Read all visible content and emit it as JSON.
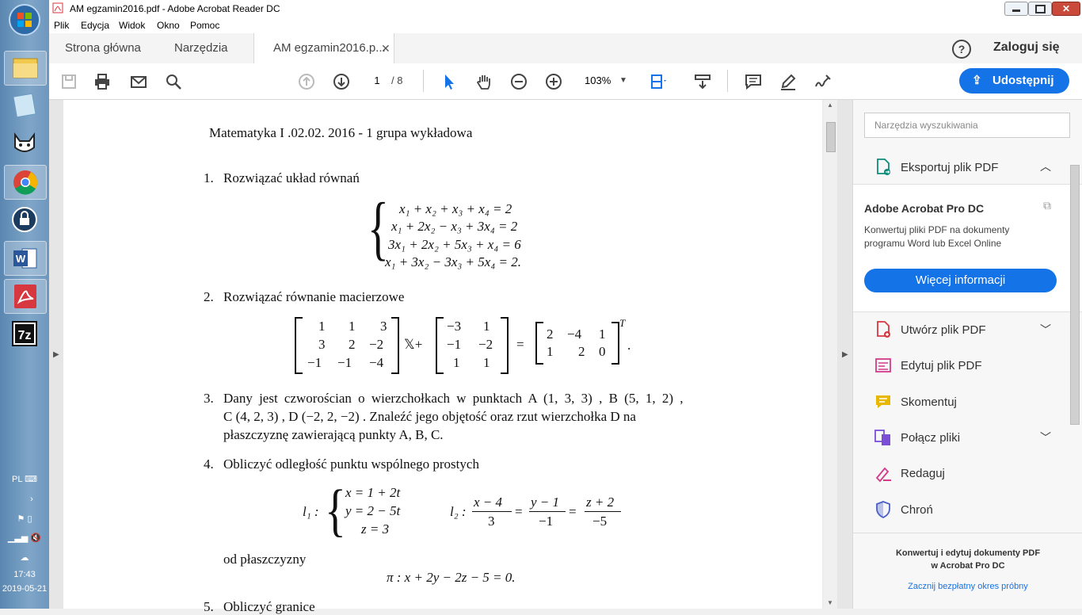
{
  "window": {
    "title": "AM egzamin2016.pdf - Adobe Acrobat Reader DC"
  },
  "menu": [
    "Plik",
    "Edycja",
    "Widok",
    "Okno",
    "Pomoc"
  ],
  "tabs": {
    "home": "Strona główna",
    "tools": "Narzędzia",
    "doc": "AM egzamin2016.p..."
  },
  "account": {
    "login": "Zaloguj się"
  },
  "toolbar": {
    "page_current": "1",
    "page_total": "/ 8",
    "zoom": "103%",
    "share": "Udostępnij"
  },
  "taskbar": {
    "lang": "PL",
    "time": "17:43",
    "date": "2019-05-21"
  },
  "document": {
    "header": "Matematyka I .02.02. 2016 - 1 grupa wykładowa",
    "p1": {
      "num": "1.",
      "text": "Rozwiązać układ równań",
      "eqs": [
        "x₁ + x₂ + x₃ + x₄ = 2",
        "x₁ + 2x₂ − x₃ + 3x₄ = 2",
        "3x₁ + 2x₂ + 5x₃ + x₄ = 6",
        "x₁ + 3x₂ − 3x₃ + 5x₄ = 2."
      ]
    },
    "p2": {
      "num": "2.",
      "text": "Rozwiązać równanie macierzowe",
      "m1": [
        [
          "1",
          "1",
          "3"
        ],
        [
          "3",
          "2",
          "−2"
        ],
        [
          "−1",
          "−1",
          "−4"
        ]
      ],
      "xplus": "𝕏+",
      "m2": [
        [
          "−3",
          "1"
        ],
        [
          "−1",
          "−2"
        ],
        [
          "1",
          "1"
        ]
      ],
      "eq": "=",
      "m3": [
        [
          "2",
          "−4",
          "1"
        ],
        [
          "1",
          "2",
          "0"
        ]
      ],
      "T": "T",
      "dot": "."
    },
    "p3": {
      "num": "3.",
      "l1": "Dany jest czworościan o wierzchołkach w punktach A (1, 3, 3) , B (5, 1, 2) ,",
      "l2": "C (4, 2, 3) , D (−2, 2, −2) . Znaleźć jego objętość oraz rzut wierzchołka D na",
      "l3": "płaszczyznę zawierającą punkty A, B, C."
    },
    "p4": {
      "num": "4.",
      "text": "Obliczyć odległość punktu wspólnego prostych",
      "l1label": "l₁ :",
      "l1eqs": [
        "x = 1 + 2t",
        "y = 2 − 5t",
        "z = 3"
      ],
      "l2label": "l₂ :",
      "frac1": {
        "n": "x − 4",
        "d": "3"
      },
      "frac2": {
        "n": "y − 1",
        "d": "−1"
      },
      "frac3": {
        "n": "z + 2",
        "d": "−5"
      },
      "eqsign": "=",
      "plane_text": "od płaszczyzny",
      "plane_eq": "π : x + 2y − 2z − 5 = 0."
    },
    "p5": {
      "num": "5.",
      "text": "Obliczyć granice"
    }
  },
  "rightpane": {
    "search_placeholder": "Narzędzia wyszukiwania",
    "export": "Eksportuj plik PDF",
    "promo_title": "Adobe Acrobat Pro DC",
    "promo_text1": "Konwertuj pliki PDF na dokumenty",
    "promo_text2": "programu Word lub Excel Online",
    "more": "Więcej informacji",
    "create": "Utwórz plik PDF",
    "edit": "Edytuj plik PDF",
    "comment": "Skomentuj",
    "combine": "Połącz pliki",
    "redact": "Redaguj",
    "protect": "Chroń",
    "footer1": "Konwertuj i edytuj dokumenty PDF",
    "footer2": "w Acrobat Pro DC",
    "trial": "Zacznij bezpłatny okres próbny"
  },
  "colors": {
    "accent": "#1473e6",
    "red": "#d7373f",
    "purple": "#7a4fd6",
    "yellow": "#e8b700",
    "pink": "#d43a8a"
  }
}
